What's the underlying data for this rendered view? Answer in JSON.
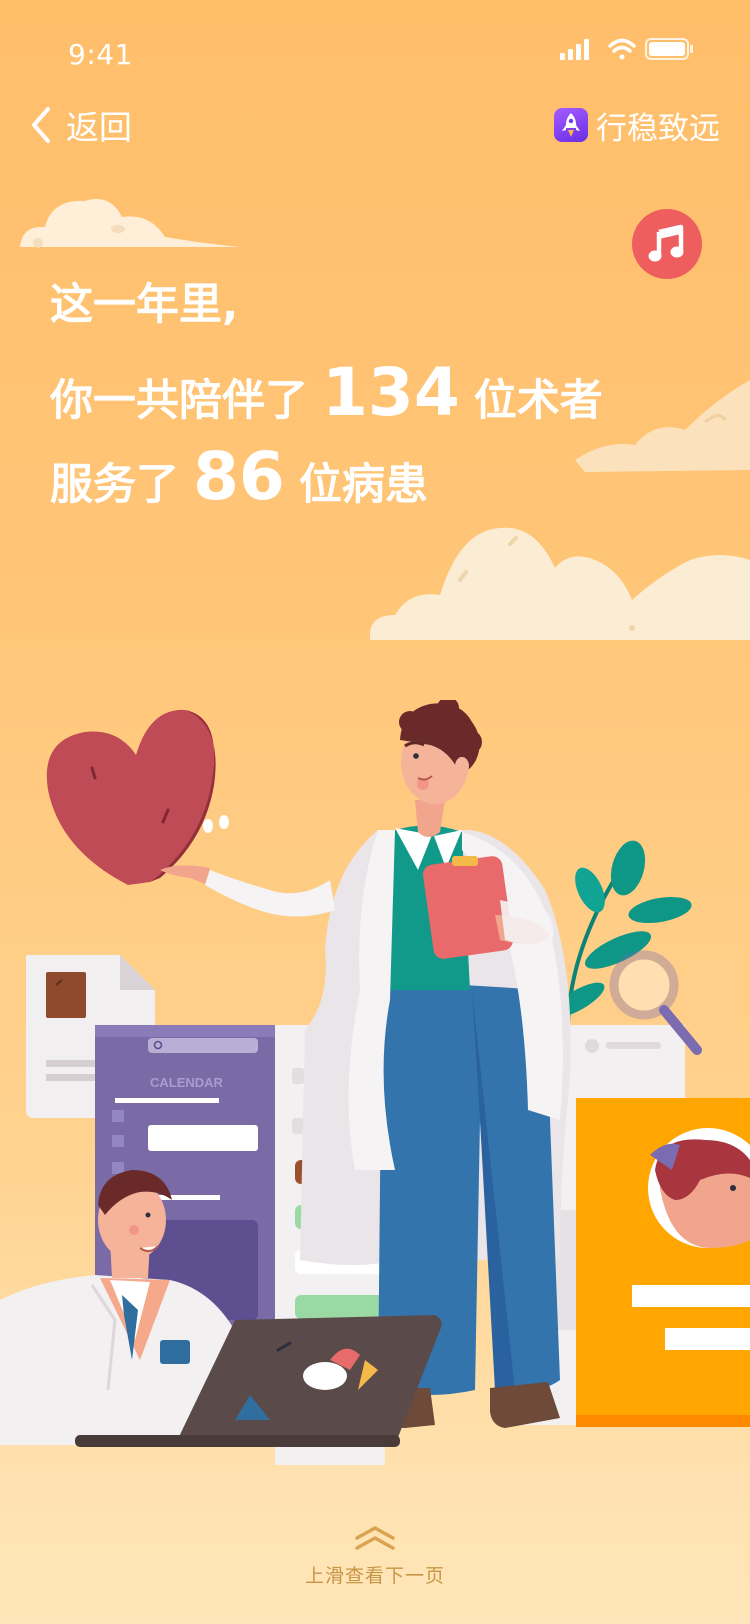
{
  "status_bar": {
    "time": "9:41",
    "icons": [
      "signal-icon",
      "wifi-icon",
      "battery-icon"
    ]
  },
  "nav": {
    "back_label": "返回",
    "app_name": "行稳致远",
    "app_icon": "rocket-icon"
  },
  "music_button": {
    "icon": "music-note-icon",
    "color": "#ee5e5e"
  },
  "summary": {
    "line1": "这一年里,",
    "line2_prefix": "你一共陪伴了",
    "operators_count": "134",
    "line2_suffix": "位术者",
    "line3_prefix": "服务了",
    "patients_count": "86",
    "line3_suffix": "位病患"
  },
  "illustration": {
    "calendar_label": "CALENDAR"
  },
  "footer": {
    "swipe_hint": "上滑查看下一页",
    "arrow_icon": "double-chevron-up-icon"
  },
  "colors": {
    "background_top": "#ffbe6a",
    "background_bottom": "#ffe6ba",
    "accent_red": "#ee5e5e",
    "hint_text": "#c89545"
  }
}
